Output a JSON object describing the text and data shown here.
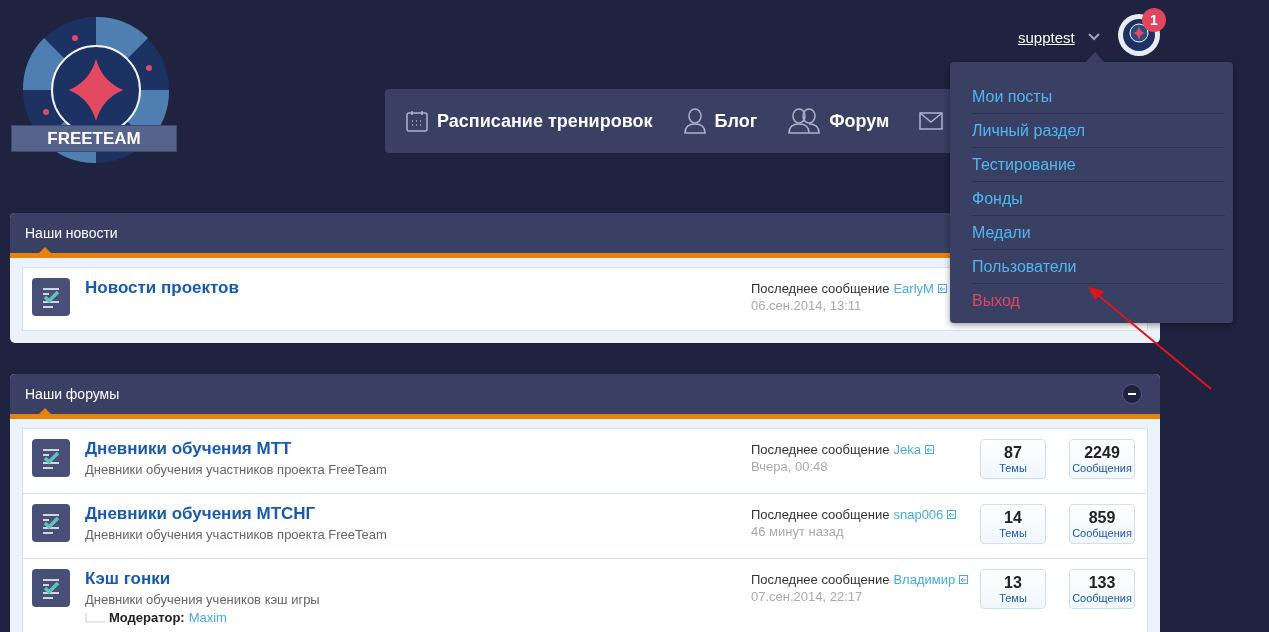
{
  "logo": {
    "text": "FREETEAM"
  },
  "user": {
    "name": "supptest",
    "notifications": "1"
  },
  "nav": [
    {
      "kind": "calendar",
      "label": "Расписание тренировок"
    },
    {
      "kind": "person",
      "label": "Блог"
    },
    {
      "kind": "people",
      "label": "Форум"
    },
    {
      "kind": "mail"
    }
  ],
  "user_menu": {
    "open": true,
    "items": [
      {
        "kind": "link",
        "label": "Мои посты"
      },
      {
        "kind": "link",
        "label": "Личный раздел"
      },
      {
        "kind": "link",
        "label": "Тестирование"
      },
      {
        "kind": "link",
        "label": "Фонды"
      },
      {
        "kind": "link",
        "label": "Медали"
      },
      {
        "kind": "link",
        "label": "Пользователи"
      },
      {
        "kind": "logout",
        "label": "Выход"
      }
    ]
  },
  "sections": [
    {
      "title": "Наши новости",
      "forums": [
        {
          "kind": "forum",
          "title": "Новости проектов",
          "last_post_label": "Последнее сообщение",
          "last_post_user": "EarlyM",
          "last_post_time": "06.сен.2014, 13:11"
        }
      ]
    },
    {
      "title": "Наши форумы",
      "collapsible": true,
      "forums": [
        {
          "kind": "forum",
          "title": "Дневники обучения МТТ",
          "description": "Дневники обучения участников проекта FreeTeam",
          "last_post_label": "Последнее сообщение",
          "last_post_user": "Jeka",
          "last_post_time": "Вчера, 00:48",
          "topics": "87",
          "topics_label": "Темы",
          "posts": "2249",
          "posts_label": "Сообщения"
        },
        {
          "kind": "forum",
          "title": "Дневники обучения МТСНГ",
          "description": "Дневники обучения участников проекта FreeTeam",
          "last_post_label": "Последнее сообщение",
          "last_post_user": "snap006",
          "last_post_time": "46 минут назад",
          "topics": "14",
          "topics_label": "Темы",
          "posts": "859",
          "posts_label": "Сообщения"
        },
        {
          "kind": "forum",
          "title": "Кэш гонки",
          "description": "Дневники обучения учеников кэш игры",
          "moderator_label": "Модератор:",
          "moderator": "Maxim",
          "last_post_label": "Последнее сообщение",
          "last_post_user": "Владимир",
          "last_post_time": "07.сен.2014, 22:17",
          "topics": "13",
          "topics_label": "Темы",
          "posts": "133",
          "posts_label": "Сообщения"
        },
        {
          "kind": "cut"
        }
      ]
    }
  ]
}
